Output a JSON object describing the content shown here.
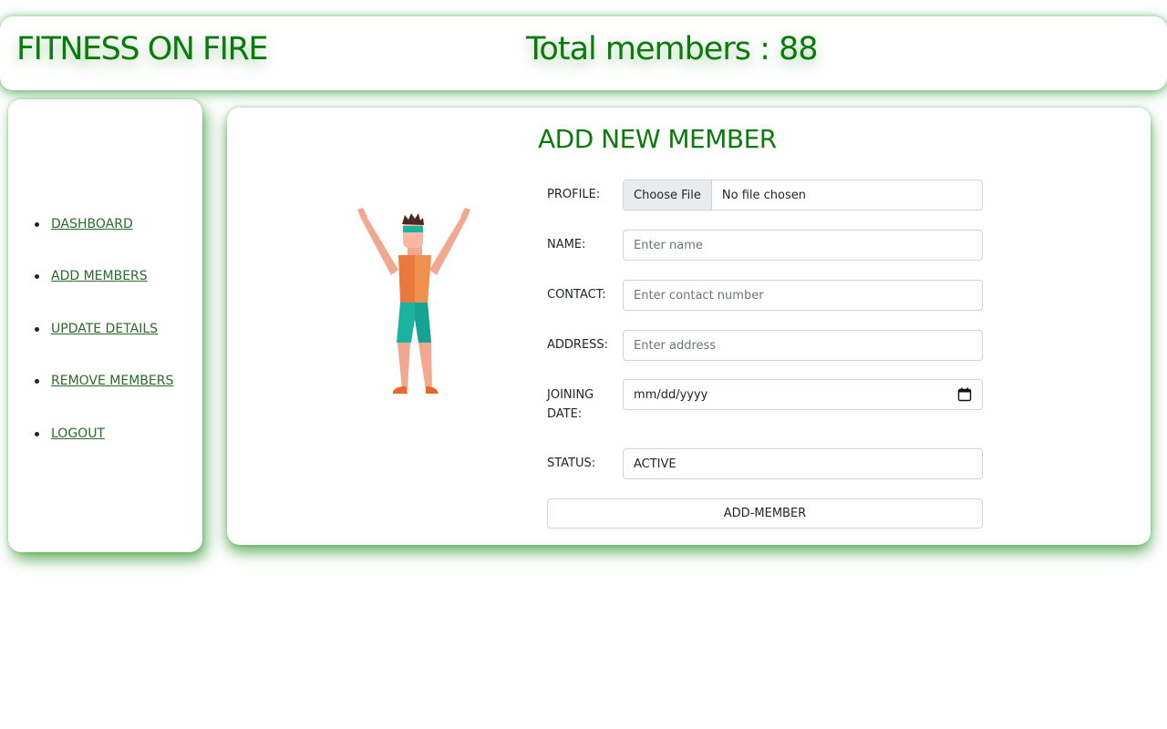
{
  "header": {
    "brand": "FITNESS ON FIRE",
    "total_members": "Total members : 88"
  },
  "sidebar": {
    "items": [
      {
        "label": "DASHBOARD"
      },
      {
        "label": "ADD MEMBERS"
      },
      {
        "label": "UPDATE DETAILS"
      },
      {
        "label": "REMOVE MEMBERS"
      },
      {
        "label": "LOGOUT"
      }
    ]
  },
  "form": {
    "title": "ADD NEW MEMBER",
    "profile": {
      "label": "PROFILE:",
      "button": "Choose File",
      "status": "No file chosen"
    },
    "name": {
      "label": "NAME:",
      "placeholder": "Enter name"
    },
    "contact": {
      "label": "CONTACT:",
      "placeholder": "Enter contact number"
    },
    "address": {
      "label": "ADDRESS:",
      "placeholder": "Enter address"
    },
    "joining_date": {
      "label_line1": "JOINING",
      "label_line2": "DATE:",
      "value": "mm/dd/yyyy"
    },
    "status": {
      "label": "STATUS:",
      "value": "ACTIVE"
    },
    "submit": "ADD-MEMBER"
  },
  "colors": {
    "brand_green": "#0b7a0b",
    "link_green": "#2a6a2a",
    "shadow_green": "#008000"
  },
  "icons": [
    "fitness-man-illustration",
    "calendar-icon"
  ]
}
